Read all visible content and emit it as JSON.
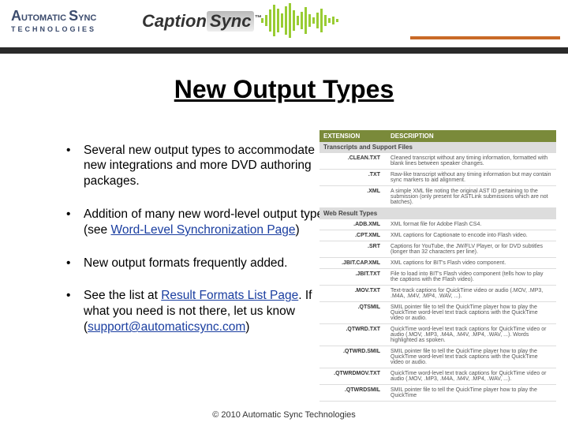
{
  "header": {
    "logo_ast_word1": "UTOMATIC",
    "logo_ast_word2": "YNC",
    "logo_ast_line2": "TECHNOLOGIES",
    "logo_cs_caption": "Caption",
    "logo_cs_sync": "Sync",
    "logo_cs_tm": "™"
  },
  "title": "New Output Types",
  "bullets": {
    "b1": "Several new output types to accommodate new integrations and more DVD authoring packages.",
    "b2a": "Addition of many new word-level output types (see ",
    "b2link": "Word-Level Synchronization Page",
    "b2b": ")",
    "b3": "New output formats frequently added.",
    "b4a": "See the list at ",
    "b4link1": "Result Formats List Page",
    "b4b": ".  If what you need is not there, let us know (",
    "b4link2": "support@automaticsync.com",
    "b4c": ")"
  },
  "table": {
    "h1": "EXTENSION",
    "h2": "DESCRIPTION",
    "s1": "Transcripts and Support Files",
    "r": [
      {
        "e": ".CLEAN.TXT",
        "d": "Cleaned transcript without any timing information, formatted with blank lines between speaker changes."
      },
      {
        "e": ".TXT",
        "d": "Raw-like transcript without any timing information but may contain sync markers to aid alignment."
      },
      {
        "e": ".XML",
        "d": "A simple XML file noting the original AST ID pertaining to the submission (only present for ASTLink submissions which are not batches)."
      }
    ],
    "s2": "Web Result Types",
    "r2": [
      {
        "e": ".ADB.XML",
        "d": "XML format file for Adobe Flash CS4."
      },
      {
        "e": ".CPT.XML",
        "d": "XML captions for Captionate to encode into Flash video."
      },
      {
        "e": ".SRT",
        "d": "Captions for YouTube, the JW/FLV Player, or for DVD subtitles (longer than 32 characters per line)."
      },
      {
        "e": ".JBIT.CAP.XML",
        "d": "XML captions for BIT's Flash video component."
      },
      {
        "e": ".JBIT.TXT",
        "d": "File to load into BIT's Flash video component (tells how to play the captions with the Flash video)."
      },
      {
        "e": ".MOV.TXT",
        "d": "Text-track captions for QuickTime video or audio (.MOV, .MP3, .M4A, .M4V, .MP4, .WAV, ...)."
      },
      {
        "e": ".QTSMIL",
        "d": "SMIL pointer file to tell the QuickTime player how to play the QuickTime word-level text track captions with the QuickTime video or audio."
      },
      {
        "e": ".QTWRD.TXT",
        "d": "QuickTime word-level text track captions for QuickTime video or audio (.MOV, .MP3, .M4A, .M4V, .MP4, .WAV, ...). Words highlighted as spoken."
      },
      {
        "e": ".QTWRD.SMIL",
        "d": "SMIL pointer file to tell the QuickTime player how to play the QuickTime word-level text track captions with the QuickTime video or audio."
      },
      {
        "e": ".QTWRDMOV.TXT",
        "d": "QuickTime word-level text track captions for QuickTime video or audio (.MOV, .MP3, .M4A, .M4V, .MP4, .WAV, ...)."
      },
      {
        "e": ".QTWRDSMIL",
        "d": "SMIL pointer file to tell the QuickTime player how to play the QuickTime"
      }
    ]
  },
  "footer": "© 2010 Automatic Sync Technologies"
}
